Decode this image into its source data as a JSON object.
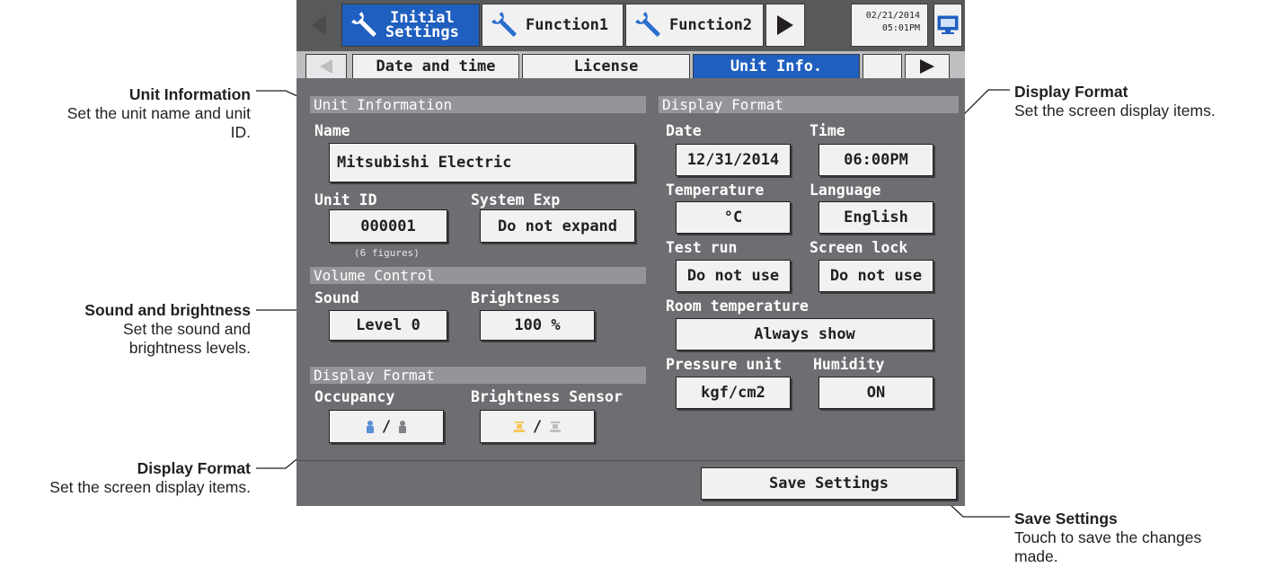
{
  "callouts": {
    "unit_info": {
      "title": "Unit Information",
      "desc_line1": "Set the unit name and unit",
      "desc_line2": "ID."
    },
    "sound": {
      "title": "Sound and brightness",
      "desc_line1": "Set the sound and",
      "desc_line2": "brightness levels."
    },
    "display_left": {
      "title": "Display Format",
      "desc_line1": "Set the screen display items."
    },
    "display_right": {
      "title": "Display Format",
      "desc_line1": "Set the screen display items."
    },
    "save": {
      "title": "Save Settings",
      "desc_line1": "Touch to save the changes",
      "desc_line2": "made."
    }
  },
  "top_tabs": {
    "initial_line1": "Initial",
    "initial_line2": "Settings",
    "function1": "Function1",
    "function2": "Function2"
  },
  "clock": {
    "date": "02/21/2014",
    "time": "05:01PM"
  },
  "sub_tabs": {
    "date_time": "Date and time",
    "license": "License",
    "unit_info": "Unit Info."
  },
  "unit_information": {
    "header": "Unit Information",
    "name_label": "Name",
    "name_value": "Mitsubishi Electric",
    "unit_id_label": "Unit ID",
    "unit_id_value": "000001",
    "unit_id_note": "(6 figures)",
    "system_exp_label": "System Exp",
    "system_exp_value": "Do not expand"
  },
  "volume_control": {
    "header": "Volume Control",
    "sound_label": "Sound",
    "sound_value": "Level 0",
    "brightness_label": "Brightness",
    "brightness_value": "100 %"
  },
  "display_format_left": {
    "header": "Display Format",
    "occupancy_label": "Occupancy",
    "brightness_sensor_label": "Brightness Sensor",
    "slash": "/"
  },
  "display_format_right": {
    "header": "Display Format",
    "date_label": "Date",
    "date_value": "12/31/2014",
    "time_label": "Time",
    "time_value": "06:00PM",
    "temperature_label": "Temperature",
    "temperature_value": "°C",
    "language_label": "Language",
    "language_value": "English",
    "test_run_label": "Test run",
    "test_run_value": "Do not use",
    "screen_lock_label": "Screen lock",
    "screen_lock_value": "Do not use",
    "room_temp_label": "Room temperature",
    "room_temp_value": "Always show",
    "pressure_unit_label": "Pressure unit",
    "pressure_unit_value": "kgf/cm2",
    "humidity_label": "Humidity",
    "humidity_value": "ON"
  },
  "save_button": "Save Settings",
  "colors": {
    "screen_bg": "#6d6e71",
    "top_bar": "#58595b",
    "active_tab": "#1f5fbf",
    "section_header": "#939598",
    "button_face": "#f1f1f2"
  },
  "icons": [
    "wrench-icon",
    "monitor-icon",
    "arrow-left-icon",
    "arrow-right-icon",
    "occupancy-person-icon",
    "brightness-sensor-icon"
  ]
}
